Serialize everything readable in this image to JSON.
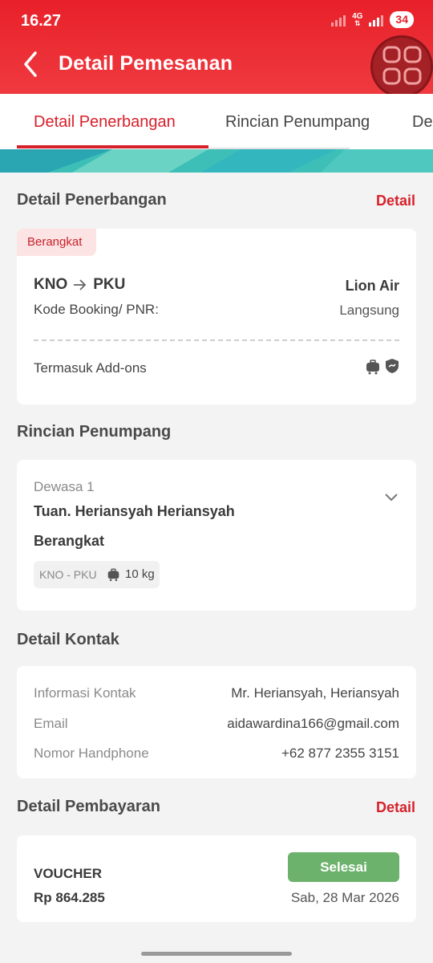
{
  "status_bar": {
    "time": "16.27",
    "network": "4G",
    "battery": "34"
  },
  "header": {
    "title": "Detail Pemesanan"
  },
  "tabs": [
    {
      "label": "Detail Penerbangan",
      "active": true
    },
    {
      "label": "Rincian Penumpang",
      "active": false
    },
    {
      "label": "De",
      "active": false
    }
  ],
  "flight": {
    "section_title": "Detail Penerbangan",
    "detail_link": "Detail",
    "badge": "Berangkat",
    "origin": "KNO",
    "destination": "PKU",
    "airline": "Lion Air",
    "booking_label": "Kode Booking/ PNR:",
    "flight_type": "Langsung",
    "addons_label": "Termasuk Add-ons"
  },
  "passenger": {
    "section_title": "Rincian Penumpang",
    "category": "Dewasa 1",
    "name": "Tuan. Heriansyah Heriansyah",
    "direction": "Berangkat",
    "route": "KNO - PKU",
    "baggage": "10 kg"
  },
  "contact": {
    "section_title": "Detail Kontak",
    "rows": [
      {
        "label": "Informasi Kontak",
        "value": "Mr. Heriansyah, Heriansyah"
      },
      {
        "label": "Email",
        "value": "aidawardina166@gmail.com"
      },
      {
        "label": "Nomor Handphone",
        "value": "+62 877 2355 3151"
      }
    ]
  },
  "payment": {
    "section_title": "Detail Pembayaran",
    "detail_link": "Detail",
    "method": "VOUCHER",
    "amount": "Rp 864.285",
    "status": "Selesai",
    "date": "Sab, 28 Mar 2026"
  },
  "colors": {
    "brand_red": "#e8202a",
    "success_green": "#6cb26c",
    "teal_accent": "#3dbfb8"
  }
}
